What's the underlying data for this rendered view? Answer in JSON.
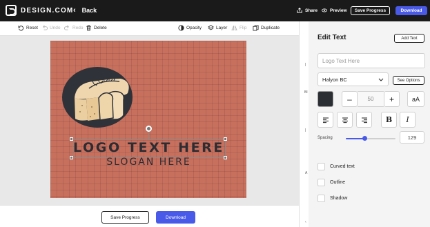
{
  "header": {
    "brand": "DESIGN.COM",
    "back_label": "Back",
    "share_label": "Share",
    "preview_label": "Preview",
    "save_label": "Save Progress",
    "download_label": "Download"
  },
  "toolbar": {
    "reset": "Reset",
    "undo": "Undo",
    "redo": "Redo",
    "delete": "Delete",
    "opacity": "Opacity",
    "layer": "Layer",
    "flip": "Flip",
    "duplicate": "Duplicate"
  },
  "canvas": {
    "background_color": "#c7705e",
    "logo_text": "LOGO TEXT HERE",
    "slogan_text": "SLOGAN HERE"
  },
  "footer": {
    "save_label": "Save Progress",
    "download_label": "Download"
  },
  "side_strip": {
    "marks": [
      "Bl",
      "A"
    ]
  },
  "panel": {
    "title": "Edit Text",
    "add_text_label": "Add Text",
    "text_placeholder": "Logo Text Here",
    "font_name": "Halyon BC",
    "see_options_label": "See Options",
    "text_color": "#2b2e33",
    "minus_label": "–",
    "font_size": "50",
    "plus_label": "+",
    "case_label": "aA",
    "bold_label": "B",
    "italic_label": "I",
    "spacing_label": "Spacing",
    "spacing_value": "129",
    "spacing_slider_fraction": 0.38,
    "curved_text_label": "Curved text",
    "outline_label": "Outline",
    "shadow_label": "Shadow"
  }
}
